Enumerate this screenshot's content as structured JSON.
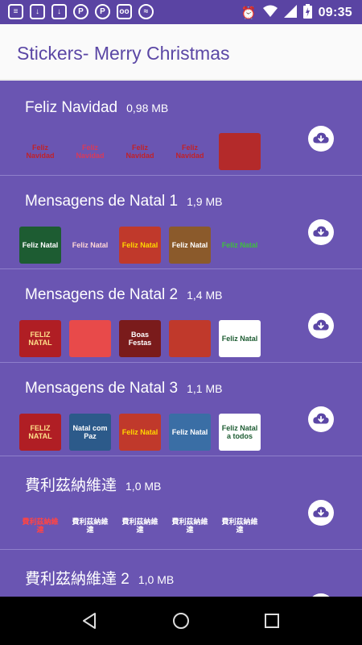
{
  "status_bar": {
    "time": "09:35",
    "left_icons": [
      "notification-icon",
      "download-icon",
      "download-icon",
      "pinterest-icon",
      "pinterest-icon",
      "voicemail-icon",
      "messenger-icon"
    ],
    "right_icons": [
      "alarm-icon",
      "wifi-icon",
      "signal-icon",
      "battery-charging-icon"
    ]
  },
  "app_bar": {
    "title": "Stickers- Merry Christmas"
  },
  "packs": [
    {
      "name": "Feliz Navidad",
      "size": "0,98 MB",
      "stickers": [
        {
          "label": "Feliz Navidad",
          "bg": "#6a55b2",
          "color": "#c0222a"
        },
        {
          "label": "Feliz Navidad",
          "bg": "#6a55b2",
          "color": "#d83a5a"
        },
        {
          "label": "Feliz Navidad",
          "bg": "#6a55b2",
          "color": "#c0222a"
        },
        {
          "label": "Feliz Navidad",
          "bg": "#6a55b2",
          "color": "#c0222a"
        },
        {
          "label": "",
          "bg": "#b42a2a",
          "color": "#ffffff"
        }
      ]
    },
    {
      "name": "Mensagens de Natal 1",
      "size": "1,9 MB",
      "stickers": [
        {
          "label": "Feliz Natal",
          "bg": "#1d5c32",
          "color": "#ffffff"
        },
        {
          "label": "Feliz Natal",
          "bg": "#6a55b2",
          "color": "#ffd6d6"
        },
        {
          "label": "Feliz Natal",
          "bg": "#c0392b",
          "color": "#ffd700"
        },
        {
          "label": "Feliz Natal",
          "bg": "#8b5a2b",
          "color": "#ffffff"
        },
        {
          "label": "Feliz Natal",
          "bg": "#6a55b2",
          "color": "#3fbf3f"
        }
      ]
    },
    {
      "name": "Mensagens de Natal 2",
      "size": "1,4 MB",
      "stickers": [
        {
          "label": "FELIZ NATAL",
          "bg": "#b01e24",
          "color": "#ffe08a"
        },
        {
          "label": "",
          "bg": "#e84a4a",
          "color": "#ffffff"
        },
        {
          "label": "Boas Festas",
          "bg": "#7a1b1b",
          "color": "#ffffff"
        },
        {
          "label": "",
          "bg": "#c0392b",
          "color": "#ffd700"
        },
        {
          "label": "Feliz Natal",
          "bg": "#ffffff",
          "color": "#1d5c32"
        }
      ]
    },
    {
      "name": "Mensagens de Natal 3",
      "size": "1,1 MB",
      "stickers": [
        {
          "label": "FELIZ NATAL",
          "bg": "#b01e24",
          "color": "#ffe08a"
        },
        {
          "label": "Natal com Paz",
          "bg": "#2c5a8a",
          "color": "#ffffff"
        },
        {
          "label": "Feliz Natal",
          "bg": "#c0392b",
          "color": "#ffd700"
        },
        {
          "label": "Feliz Natal",
          "bg": "#3a6ea5",
          "color": "#ffffff"
        },
        {
          "label": "Feliz Natal a todos",
          "bg": "#ffffff",
          "color": "#1d5c32"
        }
      ]
    },
    {
      "name": "費利茲納維達",
      "size": "1,0 MB",
      "stickers": [
        {
          "label": "費利茲納維達",
          "bg": "#6a55b2",
          "color": "#ff4444"
        },
        {
          "label": "費利茲納維達",
          "bg": "#6a55b2",
          "color": "#ffffff"
        },
        {
          "label": "費利茲納維達",
          "bg": "#6a55b2",
          "color": "#ffffff"
        },
        {
          "label": "費利茲納維達",
          "bg": "#6a55b2",
          "color": "#ffffff"
        },
        {
          "label": "費利茲納維達",
          "bg": "#6a55b2",
          "color": "#ffffff"
        }
      ]
    },
    {
      "name": "費利茲納維達 2",
      "size": "1,0 MB",
      "stickers": []
    }
  ],
  "nav_bar": {
    "buttons": [
      "back-icon",
      "home-icon",
      "recents-icon"
    ]
  }
}
